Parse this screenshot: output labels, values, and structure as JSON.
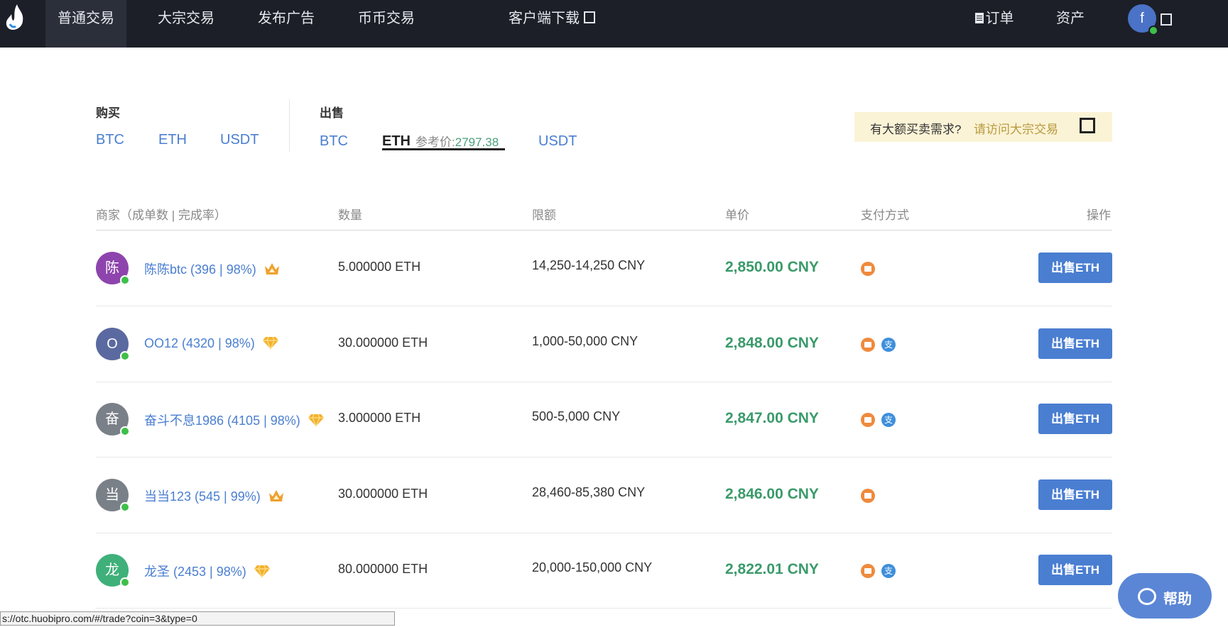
{
  "nav": {
    "items": [
      "普通交易",
      "大宗交易",
      "发布广告",
      "币币交易",
      "客户端下载"
    ],
    "orders": "订单",
    "assets": "资产",
    "avatar_letter": "f"
  },
  "tabs": {
    "buy_label": "购买",
    "buy": [
      "BTC",
      "ETH",
      "USDT"
    ],
    "sell_label": "出售",
    "sell": [
      "BTC",
      "ETH",
      "USDT"
    ],
    "active": "ETH",
    "ref_label": "参考价:",
    "ref_price": "2797.38"
  },
  "banner": {
    "text": "有大额买卖需求?",
    "link": "请访问大宗交易"
  },
  "table": {
    "headers": [
      "商家（成单数 | 完成率）",
      "数量",
      "限额",
      "单价",
      "支付方式",
      "操作"
    ],
    "rows": [
      {
        "avatar": "陈",
        "avatar_color": "#8e44ad",
        "merchant": "陈陈btc (396 | 98%)",
        "badge": "crown",
        "qty": "5.000000 ETH",
        "limit": "14,250-14,250 CNY",
        "price": "2,850.00 CNY",
        "pay": [
          "bank"
        ],
        "action": "出售ETH"
      },
      {
        "avatar": "O",
        "avatar_color": "#5a6aa0",
        "merchant": "OO12 (4320 | 98%)",
        "badge": "diamond",
        "qty": "30.000000 ETH",
        "limit": "1,000-50,000 CNY",
        "price": "2,848.00 CNY",
        "pay": [
          "bank",
          "alipay"
        ],
        "action": "出售ETH"
      },
      {
        "avatar": "奋",
        "avatar_color": "#7a8088",
        "merchant": "奋斗不息1986 (4105 | 98%)",
        "badge": "diamond",
        "qty": "3.000000 ETH",
        "limit": "500-5,000 CNY",
        "price": "2,847.00 CNY",
        "pay": [
          "bank",
          "alipay"
        ],
        "action": "出售ETH"
      },
      {
        "avatar": "当",
        "avatar_color": "#7a8088",
        "merchant": "当当123 (545 | 99%)",
        "badge": "crown",
        "qty": "30.000000 ETH",
        "limit": "28,460-85,380 CNY",
        "price": "2,846.00 CNY",
        "pay": [
          "bank"
        ],
        "action": "出售ETH"
      },
      {
        "avatar": "龙",
        "avatar_color": "#3fb07a",
        "merchant": "龙圣 (2453 | 98%)",
        "badge": "diamond",
        "qty": "80.000000 ETH",
        "limit": "20,000-150,000 CNY",
        "price": "2,822.01 CNY",
        "pay": [
          "bank",
          "alipay"
        ],
        "action": "出售ETH"
      }
    ]
  },
  "status_url": "s://otc.huobipro.com/#/trade?coin=3&type=0",
  "help_label": "帮助",
  "colors": {
    "accent": "#4a7ed1",
    "price": "#3a9a6a",
    "nav_bg": "#1c1f28"
  }
}
